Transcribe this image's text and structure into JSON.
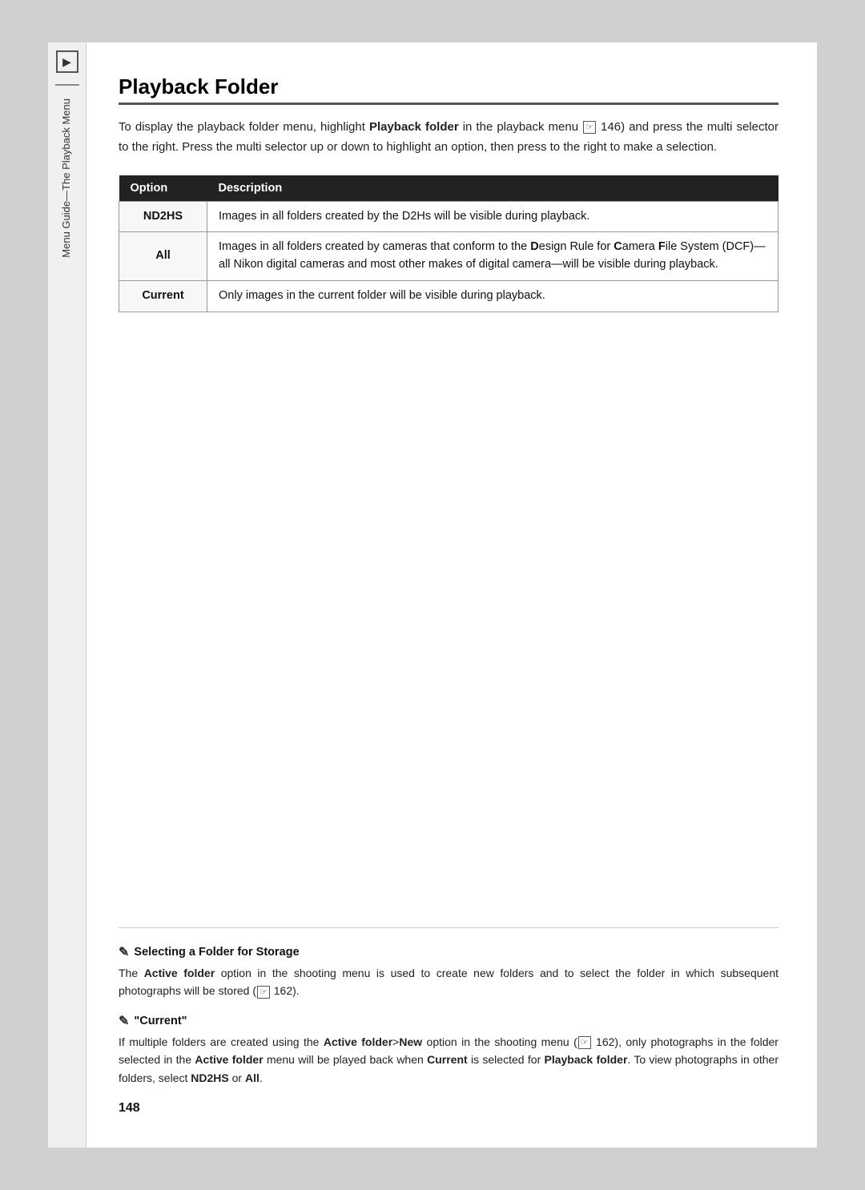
{
  "sidebar": {
    "icon_label": "▶",
    "text": "Menu Guide—The Playback Menu"
  },
  "page_title": "Playback Folder",
  "intro": {
    "text_before_bold": "To display the playback folder menu, highlight ",
    "bold1": "Playback folder",
    "text_after_bold": " in the playback menu ",
    "ref1": "146",
    "text_cont": " and press the multi selector to the right.  Press the multi selector up or down to highlight an option, then press to the right to make a selection."
  },
  "table": {
    "headers": [
      "Option",
      "Description"
    ],
    "rows": [
      {
        "option": "ND2HS",
        "description": "Images in all folders created by the D2Hs will be visible during playback."
      },
      {
        "option": "All",
        "description_parts": [
          "Images in all folders created by cameras that conform to the ",
          "D",
          "esign Rule for ",
          "C",
          "amera ",
          "F",
          "ile System (DCF)—all Nikon digital cameras and most other makes of digital camera—will be visible during playback."
        ]
      },
      {
        "option": "Current",
        "description": "Only images in the current folder will be visible during playback."
      }
    ]
  },
  "notes": [
    {
      "id": "selecting-folder",
      "title": "Selecting a Folder for Storage",
      "body_parts": [
        "The ",
        "Active folder",
        " option in the shooting menu is used to create new folders and to select the folder in which subsequent photographs will be stored (",
        "162",
        ")."
      ]
    },
    {
      "id": "current-note",
      "title": "\"Current\"",
      "body_parts": [
        "If multiple folders are created using the ",
        "Active folder",
        ">",
        "New",
        " option in the shooting menu (",
        "162",
        "), only photographs in the folder selected in the ",
        "Active folder",
        " menu will be played back when ",
        "Current",
        " is selected for ",
        "Playback folder",
        ".  To view photographs in other folders, select ",
        "ND2HS",
        " or ",
        "All",
        "."
      ]
    }
  ],
  "page_number": "148"
}
